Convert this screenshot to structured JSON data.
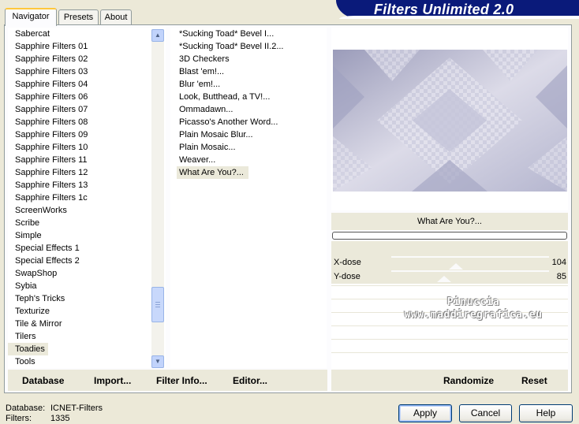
{
  "header": {
    "logo_text": "Filters Unlimited 2.0"
  },
  "tabs": [
    {
      "label": "Navigator",
      "active": true
    },
    {
      "label": "Presets",
      "active": false
    },
    {
      "label": "About",
      "active": false
    }
  ],
  "categories": {
    "items": [
      "Sabercat",
      "Sapphire Filters 01",
      "Sapphire Filters 02",
      "Sapphire Filters 03",
      "Sapphire Filters 04",
      "Sapphire Filters 06",
      "Sapphire Filters 07",
      "Sapphire Filters 08",
      "Sapphire Filters 09",
      "Sapphire Filters 10",
      "Sapphire Filters 11",
      "Sapphire Filters 12",
      "Sapphire Filters 13",
      "Sapphire Filters 1c",
      "ScreenWorks",
      "Scribe",
      "Simple",
      "Special Effects 1",
      "Special Effects 2",
      "SwapShop",
      "Sybia",
      "Teph's Tricks",
      "Texturize",
      "Tile & Mirror",
      "Tilers",
      "Toadies",
      "Tools"
    ],
    "selected": "Toadies"
  },
  "filters": {
    "items": [
      "*Sucking Toad*  Bevel I...",
      "*Sucking Toad*  Bevel II.2...",
      "3D Checkers",
      "Blast 'em!...",
      "Blur 'em!...",
      "Look, Butthead, a TV!...",
      "Ommadawn...",
      "Picasso's Another Word...",
      "Plain Mosaic Blur...",
      "Plain Mosaic...",
      "Weaver...",
      "What Are You?..."
    ],
    "selected": "What Are You?..."
  },
  "preview": {
    "filter_name": "What Are You?...",
    "progress": 0,
    "colors": {
      "base": "#b5b6cf",
      "light": "#dcdbe8",
      "dark": "#9b9cba"
    }
  },
  "parameters": [
    {
      "label": "X-dose",
      "value": 104,
      "max": 255
    },
    {
      "label": "Y-dose",
      "value": 85,
      "max": 255
    }
  ],
  "watermark": {
    "line1": "Pinuccia",
    "line2": "www.maddiregrafica.eu"
  },
  "toolbar": {
    "database": "Database",
    "import": "Import...",
    "filter_info": "Filter Info...",
    "editor": "Editor...",
    "randomize": "Randomize",
    "reset": "Reset"
  },
  "status": {
    "database_label": "Database:",
    "database_value": "ICNET-Filters",
    "filters_label": "Filters:",
    "filters_value": "1335"
  },
  "buttons": {
    "apply": "Apply",
    "cancel": "Cancel",
    "help": "Help"
  }
}
